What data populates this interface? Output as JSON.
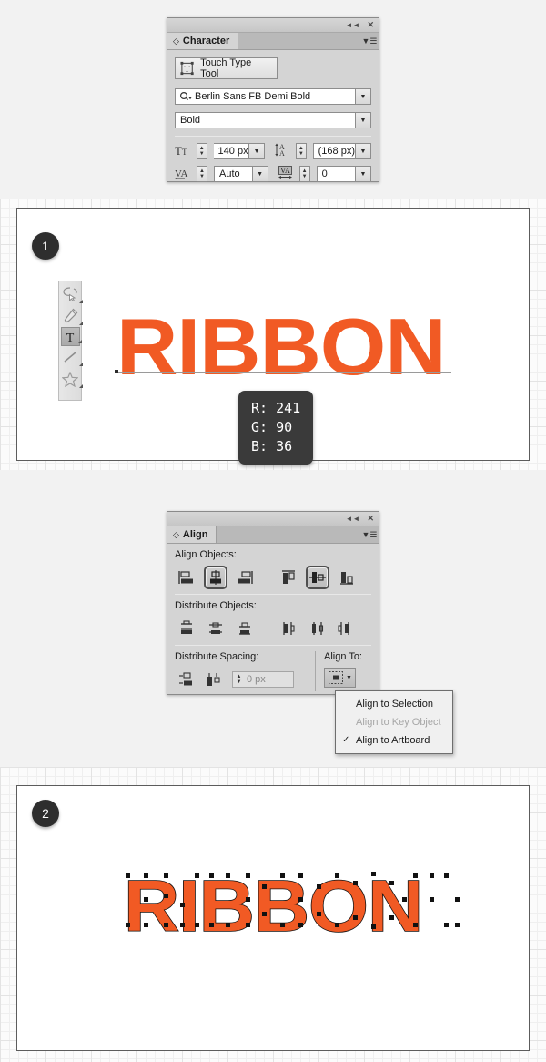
{
  "character_panel": {
    "tab_label": "Character",
    "topbar": {
      "collapse_icon": "collapse-double-arrow-icon",
      "close_icon": "close-icon",
      "menu_icon": "panel-menu-icon"
    },
    "touch_type_tool": {
      "label": "Touch Type Tool",
      "icon": "touch-type-tool-icon"
    },
    "font_family": {
      "value": "Berlin Sans FB Demi Bold",
      "search_icon": "font-search-icon",
      "dropdown_icon": "chevron-down-icon"
    },
    "font_style": {
      "value": "Bold",
      "dropdown_icon": "chevron-down-icon"
    },
    "font_size": {
      "icon": "font-size-icon",
      "value": "140 px"
    },
    "leading": {
      "icon": "leading-icon",
      "value": "(168 px)"
    },
    "kerning": {
      "icon": "kerning-icon",
      "value": "Auto"
    },
    "tracking": {
      "icon": "tracking-icon",
      "value": "0"
    }
  },
  "align_panel": {
    "tab_label": "Align",
    "align_objects_label": "Align Objects:",
    "distribute_objects_label": "Distribute Objects:",
    "distribute_spacing_label": "Distribute Spacing:",
    "align_to_label": "Align To:",
    "spacing_value": "0 px",
    "align_buttons": [
      {
        "name": "align-left-icon",
        "selected": false
      },
      {
        "name": "align-horizontal-center-icon",
        "selected": true
      },
      {
        "name": "align-right-icon",
        "selected": false
      },
      {
        "name": "align-top-icon",
        "selected": false
      },
      {
        "name": "align-vertical-center-icon",
        "selected": true
      },
      {
        "name": "align-bottom-icon",
        "selected": false
      }
    ],
    "distribute_buttons": [
      "distribute-vertical-top-icon",
      "distribute-vertical-center-icon",
      "distribute-vertical-bottom-icon",
      "distribute-horizontal-left-icon",
      "distribute-horizontal-center-icon",
      "distribute-horizontal-right-icon"
    ],
    "spacing_buttons": [
      "distribute-vertical-space-icon",
      "distribute-horizontal-space-icon"
    ],
    "align_to_button_icon": "align-to-artboard-icon",
    "menu": {
      "items": [
        {
          "label": "Align to Selection",
          "disabled": false,
          "checked": false
        },
        {
          "label": "Align to Key Object",
          "disabled": true,
          "checked": false
        },
        {
          "label": "Align to Artboard",
          "disabled": false,
          "checked": true
        }
      ],
      "check_glyph": "✓"
    }
  },
  "step1": {
    "badge": "1",
    "artwork_text": "RIBBON",
    "color": {
      "hex": "#f15a24",
      "r_label": "R: 241",
      "g_label": "G: 90",
      "b_label": "B: 36"
    },
    "tools": [
      "lasso-tool-icon",
      "pen-tool-icon",
      "type-tool-icon",
      "line-segment-tool-icon",
      "star-tool-icon"
    ]
  },
  "step2": {
    "badge": "2",
    "artwork_text": "RIBBON"
  }
}
